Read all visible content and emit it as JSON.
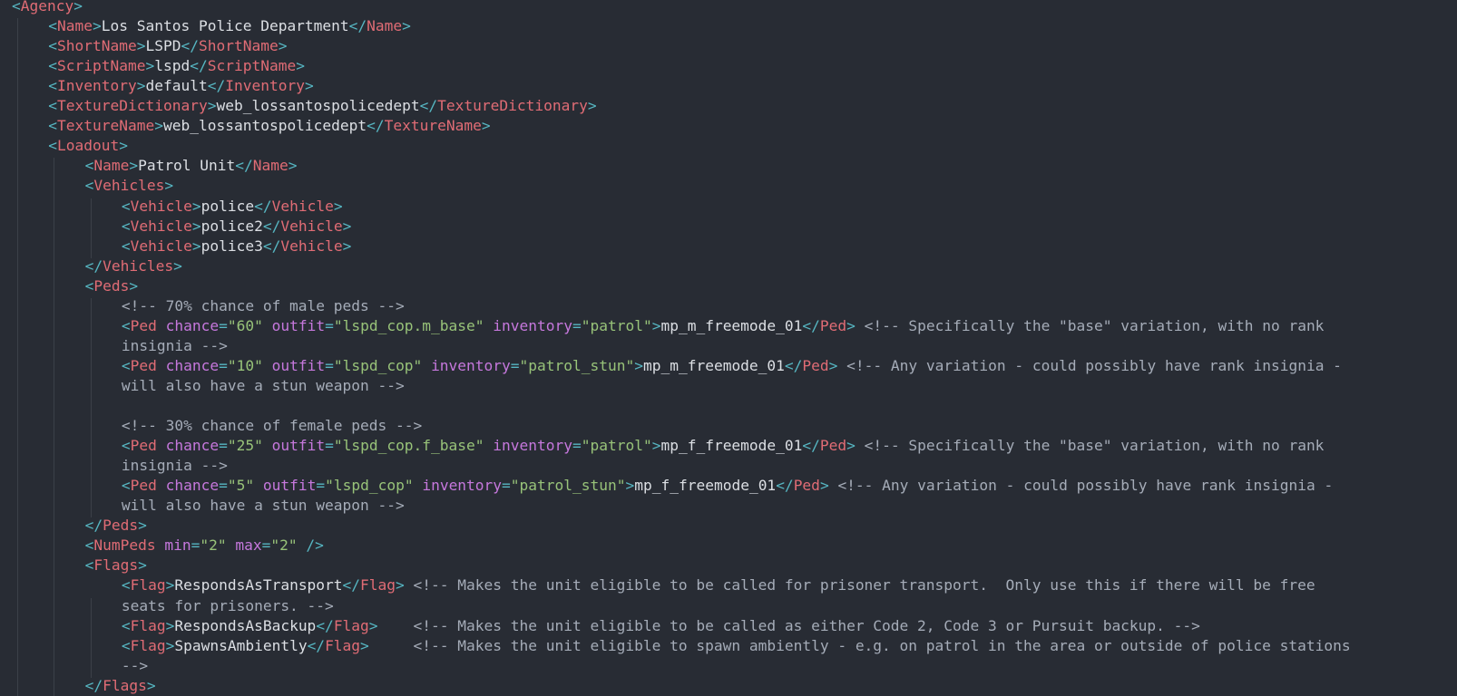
{
  "colors": {
    "background": "#282c34",
    "tag": "#e06c75",
    "punctuation": "#56b6c2",
    "attribute": "#c678dd",
    "string": "#98c379",
    "comment": "#a5acb8",
    "text": "#dcdfe4"
  },
  "lines": [
    {
      "indent": 0,
      "tokens": [
        [
          "p",
          "<"
        ],
        [
          "t",
          "Agency"
        ],
        [
          "p",
          ">"
        ]
      ]
    },
    {
      "indent": 1,
      "tokens": [
        [
          "p",
          "<"
        ],
        [
          "t",
          "Name"
        ],
        [
          "p",
          ">"
        ],
        [
          "x",
          "Los Santos Police Department"
        ],
        [
          "p",
          "</"
        ],
        [
          "t",
          "Name"
        ],
        [
          "p",
          ">"
        ]
      ]
    },
    {
      "indent": 1,
      "tokens": [
        [
          "p",
          "<"
        ],
        [
          "t",
          "ShortName"
        ],
        [
          "p",
          ">"
        ],
        [
          "x",
          "LSPD"
        ],
        [
          "p",
          "</"
        ],
        [
          "t",
          "ShortName"
        ],
        [
          "p",
          ">"
        ]
      ]
    },
    {
      "indent": 1,
      "tokens": [
        [
          "p",
          "<"
        ],
        [
          "t",
          "ScriptName"
        ],
        [
          "p",
          ">"
        ],
        [
          "x",
          "lspd"
        ],
        [
          "p",
          "</"
        ],
        [
          "t",
          "ScriptName"
        ],
        [
          "p",
          ">"
        ]
      ]
    },
    {
      "indent": 1,
      "tokens": [
        [
          "p",
          "<"
        ],
        [
          "t",
          "Inventory"
        ],
        [
          "p",
          ">"
        ],
        [
          "x",
          "default"
        ],
        [
          "p",
          "</"
        ],
        [
          "t",
          "Inventory"
        ],
        [
          "p",
          ">"
        ]
      ]
    },
    {
      "indent": 1,
      "tokens": [
        [
          "p",
          "<"
        ],
        [
          "t",
          "TextureDictionary"
        ],
        [
          "p",
          ">"
        ],
        [
          "x",
          "web_lossantospolicedept"
        ],
        [
          "p",
          "</"
        ],
        [
          "t",
          "TextureDictionary"
        ],
        [
          "p",
          ">"
        ]
      ]
    },
    {
      "indent": 1,
      "tokens": [
        [
          "p",
          "<"
        ],
        [
          "t",
          "TextureName"
        ],
        [
          "p",
          ">"
        ],
        [
          "x",
          "web_lossantospolicedept"
        ],
        [
          "p",
          "</"
        ],
        [
          "t",
          "TextureName"
        ],
        [
          "p",
          ">"
        ]
      ]
    },
    {
      "indent": 1,
      "tokens": [
        [
          "p",
          "<"
        ],
        [
          "t",
          "Loadout"
        ],
        [
          "p",
          ">"
        ]
      ]
    },
    {
      "indent": 2,
      "tokens": [
        [
          "p",
          "<"
        ],
        [
          "t",
          "Name"
        ],
        [
          "p",
          ">"
        ],
        [
          "x",
          "Patrol Unit"
        ],
        [
          "p",
          "</"
        ],
        [
          "t",
          "Name"
        ],
        [
          "p",
          ">"
        ]
      ]
    },
    {
      "indent": 2,
      "tokens": [
        [
          "p",
          "<"
        ],
        [
          "t",
          "Vehicles"
        ],
        [
          "p",
          ">"
        ]
      ]
    },
    {
      "indent": 3,
      "tokens": [
        [
          "p",
          "<"
        ],
        [
          "t",
          "Vehicle"
        ],
        [
          "p",
          ">"
        ],
        [
          "x",
          "police"
        ],
        [
          "p",
          "</"
        ],
        [
          "t",
          "Vehicle"
        ],
        [
          "p",
          ">"
        ]
      ]
    },
    {
      "indent": 3,
      "tokens": [
        [
          "p",
          "<"
        ],
        [
          "t",
          "Vehicle"
        ],
        [
          "p",
          ">"
        ],
        [
          "x",
          "police2"
        ],
        [
          "p",
          "</"
        ],
        [
          "t",
          "Vehicle"
        ],
        [
          "p",
          ">"
        ]
      ]
    },
    {
      "indent": 3,
      "tokens": [
        [
          "p",
          "<"
        ],
        [
          "t",
          "Vehicle"
        ],
        [
          "p",
          ">"
        ],
        [
          "x",
          "police3"
        ],
        [
          "p",
          "</"
        ],
        [
          "t",
          "Vehicle"
        ],
        [
          "p",
          ">"
        ]
      ]
    },
    {
      "indent": 2,
      "tokens": [
        [
          "p",
          "</"
        ],
        [
          "t",
          "Vehicles"
        ],
        [
          "p",
          ">"
        ]
      ]
    },
    {
      "indent": 2,
      "tokens": [
        [
          "p",
          "<"
        ],
        [
          "t",
          "Peds"
        ],
        [
          "p",
          ">"
        ]
      ]
    },
    {
      "indent": 3,
      "tokens": [
        [
          "c",
          "<!-- 70% chance of male peds -->"
        ]
      ]
    },
    {
      "indent": 3,
      "tokens": [
        [
          "p",
          "<"
        ],
        [
          "t",
          "Ped"
        ],
        [
          "x",
          " "
        ],
        [
          "a",
          "chance"
        ],
        [
          "p",
          "="
        ],
        [
          "v",
          "\"60\""
        ],
        [
          "x",
          " "
        ],
        [
          "a",
          "outfit"
        ],
        [
          "p",
          "="
        ],
        [
          "v",
          "\"lspd_cop.m_base\""
        ],
        [
          "x",
          " "
        ],
        [
          "a",
          "inventory"
        ],
        [
          "p",
          "="
        ],
        [
          "v",
          "\"patrol\""
        ],
        [
          "p",
          ">"
        ],
        [
          "x",
          "mp_m_freemode_01"
        ],
        [
          "p",
          "</"
        ],
        [
          "t",
          "Ped"
        ],
        [
          "p",
          ">"
        ],
        [
          "x",
          " "
        ],
        [
          "c",
          "<!-- Specifically the \"base\" variation, with no rank"
        ]
      ]
    },
    {
      "indent": 3,
      "tokens": [
        [
          "c",
          "insignia -->"
        ]
      ]
    },
    {
      "indent": 3,
      "tokens": [
        [
          "p",
          "<"
        ],
        [
          "t",
          "Ped"
        ],
        [
          "x",
          " "
        ],
        [
          "a",
          "chance"
        ],
        [
          "p",
          "="
        ],
        [
          "v",
          "\"10\""
        ],
        [
          "x",
          " "
        ],
        [
          "a",
          "outfit"
        ],
        [
          "p",
          "="
        ],
        [
          "v",
          "\"lspd_cop\""
        ],
        [
          "x",
          " "
        ],
        [
          "a",
          "inventory"
        ],
        [
          "p",
          "="
        ],
        [
          "v",
          "\"patrol_stun\""
        ],
        [
          "p",
          ">"
        ],
        [
          "x",
          "mp_m_freemode_01"
        ],
        [
          "p",
          "</"
        ],
        [
          "t",
          "Ped"
        ],
        [
          "p",
          ">"
        ],
        [
          "x",
          " "
        ],
        [
          "c",
          "<!-- Any variation - could possibly have rank insignia -"
        ]
      ]
    },
    {
      "indent": 3,
      "tokens": [
        [
          "c",
          "will also have a stun weapon -->"
        ]
      ]
    },
    {
      "indent": 3,
      "tokens": []
    },
    {
      "indent": 3,
      "tokens": [
        [
          "c",
          "<!-- 30% chance of female peds -->"
        ]
      ]
    },
    {
      "indent": 3,
      "tokens": [
        [
          "p",
          "<"
        ],
        [
          "t",
          "Ped"
        ],
        [
          "x",
          " "
        ],
        [
          "a",
          "chance"
        ],
        [
          "p",
          "="
        ],
        [
          "v",
          "\"25\""
        ],
        [
          "x",
          " "
        ],
        [
          "a",
          "outfit"
        ],
        [
          "p",
          "="
        ],
        [
          "v",
          "\"lspd_cop.f_base\""
        ],
        [
          "x",
          " "
        ],
        [
          "a",
          "inventory"
        ],
        [
          "p",
          "="
        ],
        [
          "v",
          "\"patrol\""
        ],
        [
          "p",
          ">"
        ],
        [
          "x",
          "mp_f_freemode_01"
        ],
        [
          "p",
          "</"
        ],
        [
          "t",
          "Ped"
        ],
        [
          "p",
          ">"
        ],
        [
          "x",
          " "
        ],
        [
          "c",
          "<!-- Specifically the \"base\" variation, with no rank"
        ]
      ]
    },
    {
      "indent": 3,
      "tokens": [
        [
          "c",
          "insignia -->"
        ]
      ]
    },
    {
      "indent": 3,
      "tokens": [
        [
          "p",
          "<"
        ],
        [
          "t",
          "Ped"
        ],
        [
          "x",
          " "
        ],
        [
          "a",
          "chance"
        ],
        [
          "p",
          "="
        ],
        [
          "v",
          "\"5\""
        ],
        [
          "x",
          " "
        ],
        [
          "a",
          "outfit"
        ],
        [
          "p",
          "="
        ],
        [
          "v",
          "\"lspd_cop\""
        ],
        [
          "x",
          " "
        ],
        [
          "a",
          "inventory"
        ],
        [
          "p",
          "="
        ],
        [
          "v",
          "\"patrol_stun\""
        ],
        [
          "p",
          ">"
        ],
        [
          "x",
          "mp_f_freemode_01"
        ],
        [
          "p",
          "</"
        ],
        [
          "t",
          "Ped"
        ],
        [
          "p",
          ">"
        ],
        [
          "x",
          " "
        ],
        [
          "c",
          "<!-- Any variation - could possibly have rank insignia -"
        ]
      ]
    },
    {
      "indent": 3,
      "tokens": [
        [
          "c",
          "will also have a stun weapon -->"
        ]
      ]
    },
    {
      "indent": 2,
      "tokens": [
        [
          "p",
          "</"
        ],
        [
          "t",
          "Peds"
        ],
        [
          "p",
          ">"
        ]
      ]
    },
    {
      "indent": 2,
      "tokens": [
        [
          "p",
          "<"
        ],
        [
          "t",
          "NumPeds"
        ],
        [
          "x",
          " "
        ],
        [
          "a",
          "min"
        ],
        [
          "p",
          "="
        ],
        [
          "v",
          "\"2\""
        ],
        [
          "x",
          " "
        ],
        [
          "a",
          "max"
        ],
        [
          "p",
          "="
        ],
        [
          "v",
          "\"2\""
        ],
        [
          "x",
          " "
        ],
        [
          "p",
          "/>"
        ]
      ]
    },
    {
      "indent": 2,
      "tokens": [
        [
          "p",
          "<"
        ],
        [
          "t",
          "Flags"
        ],
        [
          "p",
          ">"
        ]
      ]
    },
    {
      "indent": 3,
      "tokens": [
        [
          "p",
          "<"
        ],
        [
          "t",
          "Flag"
        ],
        [
          "p",
          ">"
        ],
        [
          "x",
          "RespondsAsTransport"
        ],
        [
          "p",
          "</"
        ],
        [
          "t",
          "Flag"
        ],
        [
          "p",
          ">"
        ],
        [
          "x",
          " "
        ],
        [
          "c",
          "<!-- Makes the unit eligible to be called for prisoner transport.  Only use this if there will be free"
        ]
      ]
    },
    {
      "indent": 3,
      "tokens": [
        [
          "c",
          "seats for prisoners. -->"
        ]
      ]
    },
    {
      "indent": 3,
      "tokens": [
        [
          "p",
          "<"
        ],
        [
          "t",
          "Flag"
        ],
        [
          "p",
          ">"
        ],
        [
          "x",
          "RespondsAsBackup"
        ],
        [
          "p",
          "</"
        ],
        [
          "t",
          "Flag"
        ],
        [
          "p",
          ">"
        ],
        [
          "x",
          "    "
        ],
        [
          "c",
          "<!-- Makes the unit eligible to be called as either Code 2, Code 3 or Pursuit backup. -->"
        ]
      ]
    },
    {
      "indent": 3,
      "tokens": [
        [
          "p",
          "<"
        ],
        [
          "t",
          "Flag"
        ],
        [
          "p",
          ">"
        ],
        [
          "x",
          "SpawnsAmbiently"
        ],
        [
          "p",
          "</"
        ],
        [
          "t",
          "Flag"
        ],
        [
          "p",
          ">"
        ],
        [
          "x",
          "     "
        ],
        [
          "c",
          "<!-- Makes the unit eligible to spawn ambiently - e.g. on patrol in the area or outside of police stations"
        ]
      ]
    },
    {
      "indent": 3,
      "tokens": [
        [
          "c",
          "-->"
        ]
      ]
    },
    {
      "indent": 2,
      "tokens": [
        [
          "p",
          "</"
        ],
        [
          "t",
          "Flags"
        ],
        [
          "p",
          ">"
        ]
      ]
    }
  ]
}
